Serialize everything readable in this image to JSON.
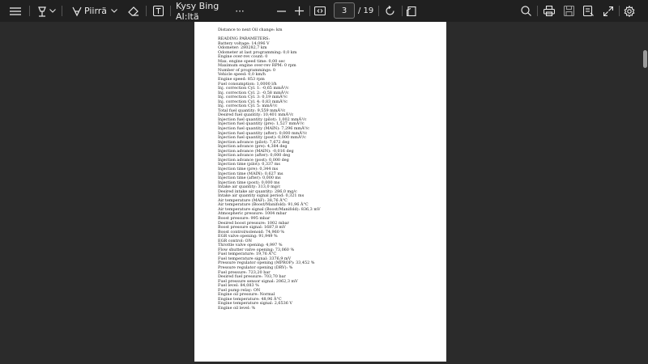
{
  "toolbar": {
    "draw_label": "Piirrä",
    "ask_label": "Kysy Bing AI:ltä",
    "more_label": "···",
    "current_page": "3",
    "total_pages": "/ 19"
  },
  "document": {
    "header": "Distance to next Oil change:  km",
    "section": "READING PARAMETERS:",
    "lines": [
      "Battery voltage: 14,096 V",
      "Odometer: 280282,7 km",
      "Odometer at last programming: 0,0 km",
      "Engine over-rev count: 0",
      "Max. engine speed time: 0,00 sec",
      "Maximum engine over-rev RPM: 0 rpm",
      "Number of programmings: 0",
      "Vehicle speed: 0,0 km/h",
      "Engine speed: 853 rpm",
      "Fuel consumption: 1,0000 l/h",
      "Inj. correction Cyl. 1: -0,65 mmÂ³/c",
      "Inj. correction Cyl. 2: -0,58 mmÂ³/c",
      "Inj. correction Cyl. 3: 0,19 mmÂ³/c",
      "Inj. correction Cyl. 4: 0,83 mmÂ³/c",
      "Inj. correction Cyl. 5:  mmÂ³/c",
      "Total fuel quantity: 9,559 mmÂ³/c",
      "Desired fuel quantity: 10,401 mmÂ³/c",
      "Injection fuel quantity (pilot): 1,002 mmÂ³/c",
      "Injection fuel quantity (pre): 1,527 mmÂ³/c",
      "Injection fuel quantity (MAIN): 7,296 mmÂ³/c",
      "Injection fuel quantity (after): 0,000 mmÂ³/c",
      "Injection fuel quantity (post): 0,000 mmÂ³/c",
      "Injection advance (pilot): 7,672 deg",
      "Injection advance (pre): 4,384 deg",
      "Injection advance (MAIN): -0,016 deg",
      "Injection advance (after): 0,000 deg",
      "Injection advance (post): 0,000 deg",
      "Injection time (pilot): 0,337 ms",
      "Injection time (pre): 0,344 ms",
      "Injection time (MAIN): 0,627 ms",
      "Injection time (after): 0,000 ms",
      "Injection time (post): 0,000 ms",
      "Intake air quantity: 313,0 mg/c",
      "Desired intake air quantity: 286,0 mg/c",
      "Intake air quantity signal period: 0,321 ms",
      "Air temperature (MAF): 38,76 Â°C",
      "Air temperature (Boost/Manifold): 91,96 Â°C",
      "Air temperature signal (Boost/Manifold): 836,3 mV",
      "Atmospheric pressure: 1004 mbar",
      "Boost pressure: 995 mbar",
      "Desired boost pressure: 1002 mbar",
      "Boost pressure signal: 1687,8 mV",
      "Boost control/solenoid: 74,960 %",
      "EGR valve opening: 91,949 %",
      "EGR control: ON",
      "Throttle valve opening: 4,997 %",
      "Flow shutter valve opening: 73,060 %",
      "Fuel temperature: 19,76 Â°C",
      "Fuel temperature signal: 3376,9 mV",
      "Pressure regulator opening (MPROP): 33,452 %",
      "Pressure regulator opening (DRV):  %",
      "Fuel pressure: 723,20 bar",
      "Desired fuel pressure: 703,70 bar",
      "Fuel pressure sensor signal: 2062,3 mV",
      "Fuel level: 84,083 %",
      "Fuel pump relay: ON",
      "Engine oil pressure: Normal",
      "Engine temperature: 48,96 Â°C",
      "Engine temperature signal: 2,6536 V",
      "Engine oil level:  %"
    ]
  },
  "colors": {
    "toolbar_bg": "#202020",
    "workspace_bg": "#2b2b2b",
    "page_bg": "#ffffff",
    "icon": "#e8e8e8"
  }
}
